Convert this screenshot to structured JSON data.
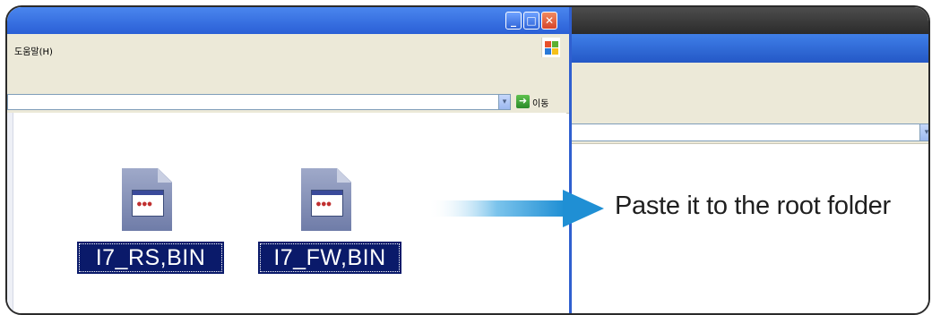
{
  "left_window": {
    "menu": {
      "help_label": "도움말(H)"
    },
    "address": {
      "go_label": "이동"
    },
    "files": [
      {
        "name": "I7_RS,BIN"
      },
      {
        "name": "I7_FW,BIN"
      }
    ]
  },
  "annotation": {
    "text": "Paste it to the root folder"
  },
  "colors": {
    "selection": "#0a1a6a",
    "arrow": "#2a9bd8",
    "titlebar": "#2a5fd6"
  },
  "icons": [
    "minimize-icon",
    "maximize-icon",
    "close-icon",
    "windows-logo-icon",
    "go-arrow-icon",
    "dropdown-arrow-icon",
    "file-icon"
  ]
}
